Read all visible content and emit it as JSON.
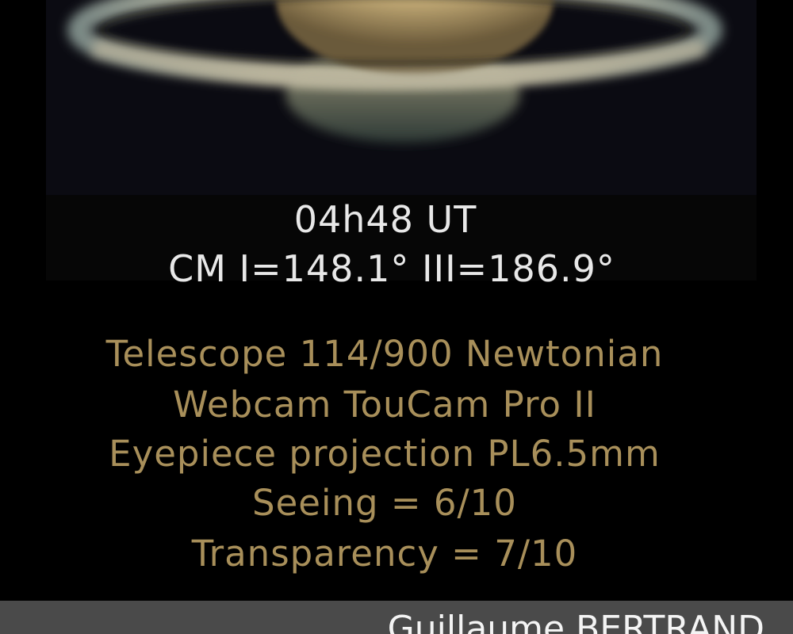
{
  "photo": {
    "subject": "saturn-icon"
  },
  "observation": {
    "time": "04h48 UT",
    "central_meridian": "CM  I=148.1° III=186.9°"
  },
  "equipment": [
    "Telescope 114/900 Newtonian",
    "Webcam TouCam Pro II",
    "Eyepiece projection PL6.5mm",
    "Seeing = 6/10",
    "Transparency = 7/10"
  ],
  "credit": {
    "author": "Guillaume BERTRAND"
  },
  "colors": {
    "background": "#000000",
    "time_text": "#e8e8e8",
    "spec_text": "#a88f5a",
    "credit_bar": "#4a4a4a"
  }
}
